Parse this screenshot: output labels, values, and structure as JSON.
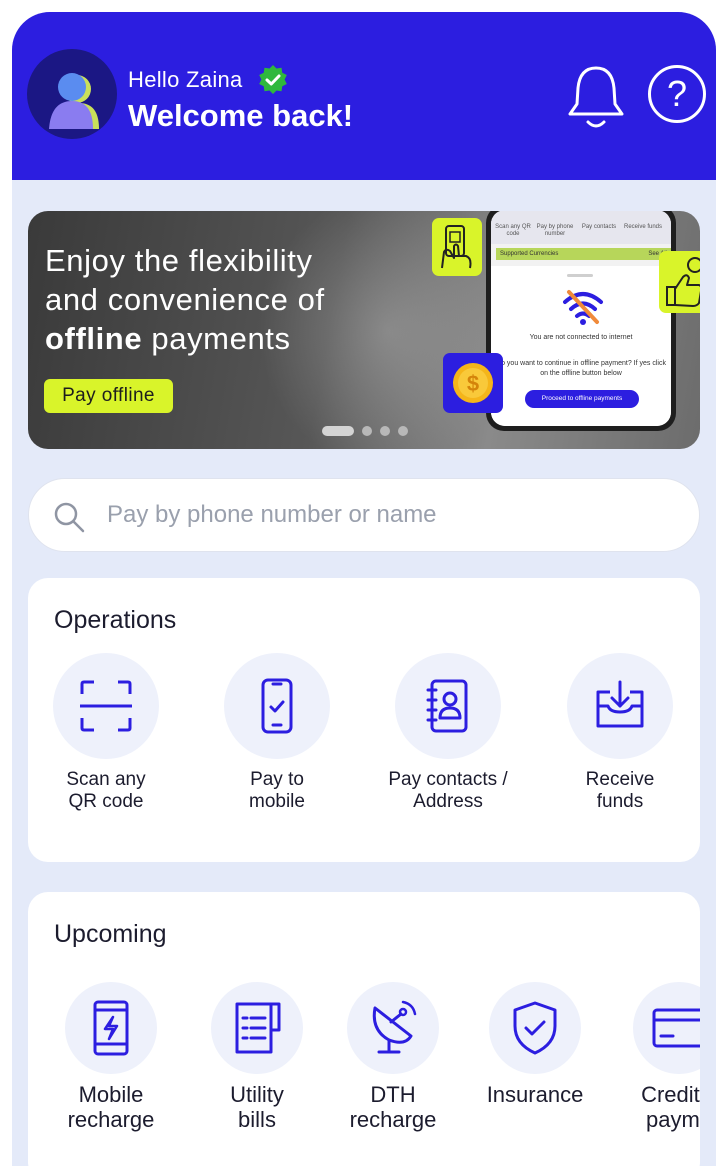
{
  "header": {
    "greeting": "Hello Zaina",
    "welcome": "Welcome back!",
    "icons": [
      "avatar",
      "verified-badge-icon",
      "bell-icon",
      "help-icon"
    ],
    "help_glyph": "?"
  },
  "banner": {
    "line1": "Enjoy the flexibility",
    "line2": "and convenience of",
    "line3_bold": "offline",
    "line3_rest": " payments",
    "button": "Pay offline",
    "slide_count": 4,
    "active_slide": 1,
    "phone": {
      "top_items": [
        "Scan any QR code",
        "Pay by phone number",
        "Pay contacts",
        "Receive funds"
      ],
      "supported": "Supported Currencies",
      "see_all": "See All",
      "not_connected": "You are not connected to internet",
      "question": "Do you want to continue in offline payment? If yes click on the offline button below",
      "proceed": "Proceed to offline payments"
    }
  },
  "search": {
    "placeholder": "Pay by phone number or name"
  },
  "operations": {
    "title": "Operations",
    "items": [
      {
        "label": "Scan any\nQR code",
        "icon": "qr-scan-icon"
      },
      {
        "label": "Pay to\nmobile",
        "icon": "mobile-pay-icon"
      },
      {
        "label": "Pay contacts /\nAddress",
        "icon": "contacts-book-icon"
      },
      {
        "label": "Receive\nfunds",
        "icon": "receive-funds-icon"
      }
    ]
  },
  "upcoming": {
    "title": "Upcoming",
    "items": [
      {
        "label": "Mobile\nrecharge",
        "icon": "mobile-recharge-icon"
      },
      {
        "label": "Utility\nbills",
        "icon": "utility-bills-icon"
      },
      {
        "label": "DTH\nrecharge",
        "icon": "satellite-dish-icon"
      },
      {
        "label": "Insurance",
        "icon": "shield-check-icon"
      },
      {
        "label": "Credit c\npayme",
        "icon": "credit-card-icon"
      }
    ]
  },
  "colors": {
    "brand": "#2c1ee0",
    "accent": "#d9f42a",
    "background": "#e4eaf9",
    "verified": "#2fb83d"
  }
}
